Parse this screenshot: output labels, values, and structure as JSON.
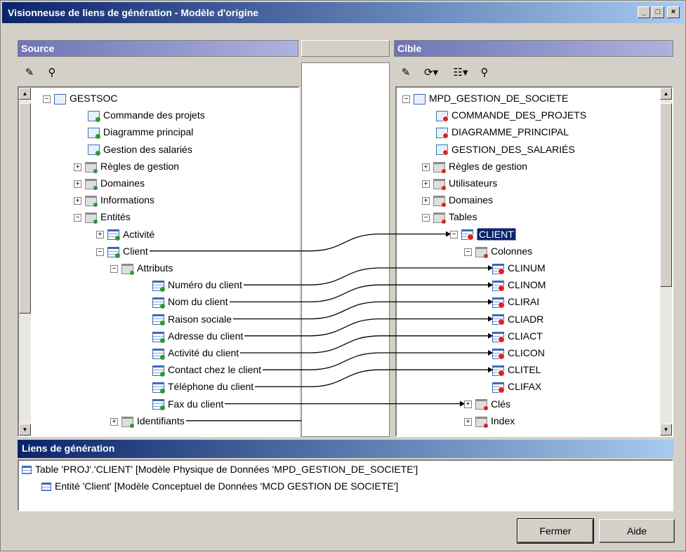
{
  "window": {
    "title": "Visionneuse de liens de génération - Modèle d'origine",
    "controls": [
      "_",
      "□",
      "×"
    ]
  },
  "source": {
    "header": "Source",
    "toolbar_icons": [
      "properties-icon",
      "find-icon"
    ],
    "nodes": [
      {
        "label": "GESTSOC",
        "icon": "model-icon",
        "expander": "−"
      },
      {
        "label": "Commande des projets",
        "icon": "diagram-icon"
      },
      {
        "label": "Diagramme principal",
        "icon": "diagram-icon"
      },
      {
        "label": "Gestion des salariés",
        "icon": "diagram-icon"
      },
      {
        "label": "Règles de gestion",
        "icon": "folder-icon",
        "expander": "+"
      },
      {
        "label": "Domaines",
        "icon": "folder-icon",
        "expander": "+"
      },
      {
        "label": "Informations",
        "icon": "folder-icon",
        "expander": "+"
      },
      {
        "label": "Entités",
        "icon": "folder-icon",
        "expander": "−"
      },
      {
        "label": "Activité",
        "icon": "entity-icon",
        "expander": "+"
      },
      {
        "label": "Client",
        "icon": "entity-icon",
        "expander": "−"
      },
      {
        "label": "Attributs",
        "icon": "folder-icon",
        "expander": "−"
      },
      {
        "label": "Numéro du client",
        "icon": "attribute-icon"
      },
      {
        "label": "Nom du client",
        "icon": "attribute-icon"
      },
      {
        "label": "Raison sociale",
        "icon": "attribute-icon"
      },
      {
        "label": "Adresse du client",
        "icon": "attribute-icon"
      },
      {
        "label": "Activité du client",
        "icon": "attribute-icon"
      },
      {
        "label": "Contact chez le client",
        "icon": "attribute-icon"
      },
      {
        "label": "Téléphone du client",
        "icon": "attribute-icon"
      },
      {
        "label": "Fax du client",
        "icon": "attribute-icon"
      },
      {
        "label": "Identifiants",
        "icon": "folder-icon",
        "expander": "+"
      }
    ]
  },
  "target": {
    "header": "Cible",
    "toolbar_icons": [
      "properties-icon",
      "generate-icon",
      "report-icon",
      "find-icon"
    ],
    "nodes": [
      {
        "label": "MPD_GESTION_DE_SOCIETE",
        "icon": "model-icon",
        "expander": "−"
      },
      {
        "label": "COMMANDE_DES_PROJETS",
        "icon": "diagram-icon"
      },
      {
        "label": "DIAGRAMME_PRINCIPAL",
        "icon": "diagram-icon"
      },
      {
        "label": "GESTION_DES_SALARIÉS",
        "icon": "diagram-icon"
      },
      {
        "label": "Règles de gestion",
        "icon": "folder-icon",
        "expander": "+"
      },
      {
        "label": "Utilisateurs",
        "icon": "folder-icon",
        "expander": "+"
      },
      {
        "label": "Domaines",
        "icon": "folder-icon",
        "expander": "+"
      },
      {
        "label": "Tables",
        "icon": "folder-icon",
        "expander": "−"
      },
      {
        "label": "CLIENT",
        "icon": "table-icon",
        "expander": "−",
        "selected": true
      },
      {
        "label": "Colonnes",
        "icon": "folder-icon",
        "expander": "−"
      },
      {
        "label": "CLINUM",
        "icon": "column-icon"
      },
      {
        "label": "CLINOM",
        "icon": "column-icon"
      },
      {
        "label": "CLIRAI",
        "icon": "column-icon"
      },
      {
        "label": "CLIADR",
        "icon": "column-icon"
      },
      {
        "label": "CLIACT",
        "icon": "column-icon"
      },
      {
        "label": "CLICON",
        "icon": "column-icon"
      },
      {
        "label": "CLITEL",
        "icon": "column-icon"
      },
      {
        "label": "CLIFAX",
        "icon": "column-icon"
      },
      {
        "label": "Clés",
        "icon": "folder-icon",
        "expander": "+"
      },
      {
        "label": "Index",
        "icon": "folder-icon",
        "expander": "+"
      }
    ]
  },
  "links_panel": {
    "header": "Liens de génération",
    "lines": [
      "Table 'PROJ'.'CLIENT' [Modèle Physique de Données 'MPD_GESTION_DE_SOCIETE']",
      "Entité 'Client' [Modèle Conceptuel de Données 'MCD GESTION DE SOCIETE']"
    ]
  },
  "buttons": {
    "close": "Fermer",
    "help": "Aide"
  }
}
